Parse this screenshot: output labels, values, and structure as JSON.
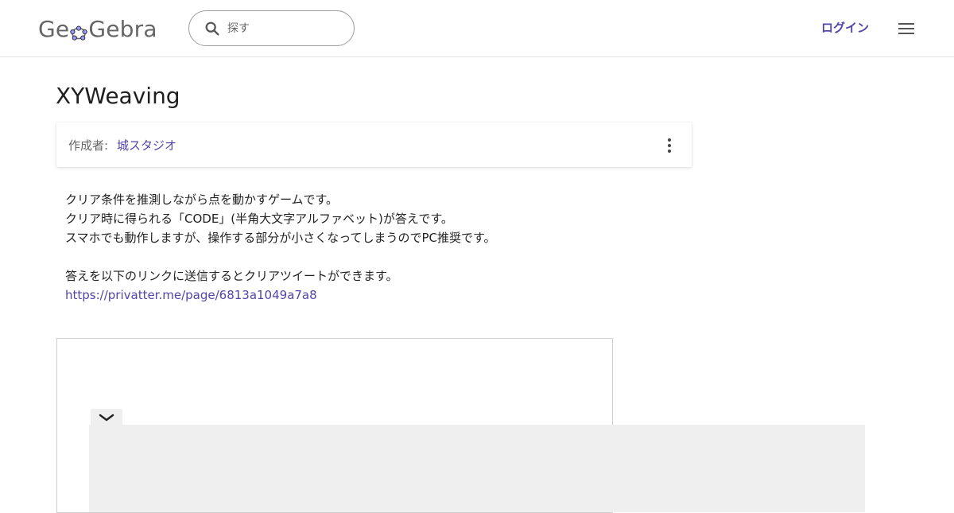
{
  "header": {
    "logo": {
      "part1": "Ge",
      "part2": "Gebra"
    },
    "search": {
      "placeholder": "探す",
      "value": ""
    },
    "login_label": "ログイン"
  },
  "page": {
    "title": "XYWeaving"
  },
  "author": {
    "label": "作成者:",
    "name": "城スタジオ"
  },
  "description": {
    "lines": [
      "クリア条件を推測しながら点を動かすゲームです。",
      "クリア時に得られる「CODE」(半角大文字アルファベット)が答えです。",
      "スマホでも動作しますが、操作する部分が小さくなってしまうのでPC推奨です。",
      "",
      "答えを以下のリンクに送信するとクリアツイートができます。"
    ],
    "link": "https://privatter.me/page/6813a1049a7a8"
  },
  "icons": {
    "logo_flower": "flower-icon",
    "search": "search-icon",
    "menu": "hamburger-menu-icon",
    "more": "more-vert-icon",
    "collapse": "chevron-down-icon"
  },
  "colors": {
    "accent": "#5145a8",
    "logo_text": "#666666",
    "divider": "#e3e3e3",
    "applet_bg": "#efefef"
  }
}
